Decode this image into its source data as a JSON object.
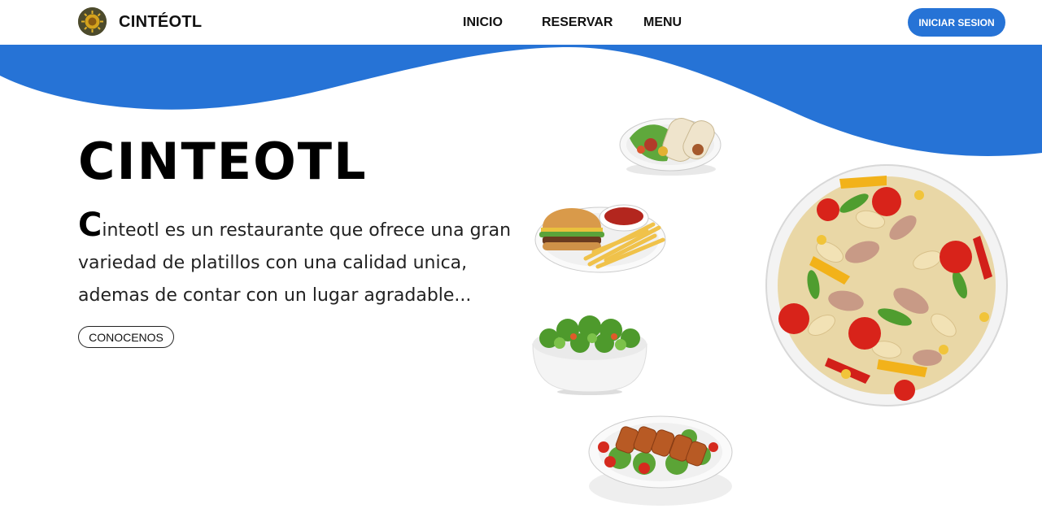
{
  "header": {
    "brand": "CINTÉOTL",
    "logo_icon": "sun-emblem-icon",
    "nav": [
      {
        "label": "INICIO"
      },
      {
        "label": "RESERVAR"
      },
      {
        "label": "MENU"
      }
    ],
    "login_label": "INICIAR SESION"
  },
  "hero": {
    "title": "CINTEOTL",
    "description_initial": "C",
    "description_rest": "inteotl es un restaurante que ofrece una gran variedad de platillos con una calidad unica, ademas de contar con un lugar agradable...",
    "cta_label": "CONOCENOS"
  },
  "images": [
    {
      "name": "burrito-plate-image"
    },
    {
      "name": "burger-fries-image"
    },
    {
      "name": "green-salad-bowl-image"
    },
    {
      "name": "chicken-salad-plate-image"
    },
    {
      "name": "pasta-salad-bowl-image"
    }
  ],
  "colors": {
    "accent": "#2673d6",
    "text": "#111111",
    "background": "#ffffff"
  }
}
